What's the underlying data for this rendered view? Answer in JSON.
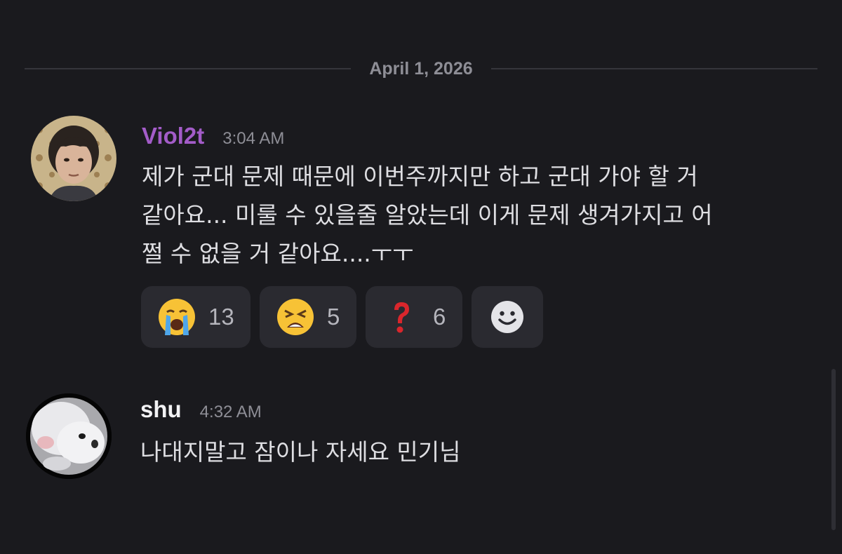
{
  "date_divider": {
    "label": "April 1, 2026"
  },
  "messages": [
    {
      "username": "Viol2t",
      "username_color": "#a35cc8",
      "timestamp": "3:04 AM",
      "lines": [
        "제가 군대 문제 때문에 이번주까지만 하고 군대 가야 할 거",
        "같아요... 미룰 수 있을줄 알았는데 이게 문제 생겨가지고 어",
        "쩔 수 없을 거 같아요....ㅜㅜ"
      ],
      "reactions": [
        {
          "emoji": "loudly-crying-face",
          "count": "13"
        },
        {
          "emoji": "weary-face",
          "count": "5"
        },
        {
          "emoji": "red-question-mark",
          "count": "6"
        }
      ],
      "add_reaction_icon": "smiley-add-reaction-icon"
    },
    {
      "username": "shu",
      "username_color": "#f2f2f4",
      "timestamp": "4:32 AM",
      "lines": [
        "나대지말고 잠이나 자세요 민기님"
      ]
    }
  ],
  "colors": {
    "background": "#1a1a1e",
    "reaction_bg": "#2a2a30",
    "muted_text": "#8e8e96"
  }
}
